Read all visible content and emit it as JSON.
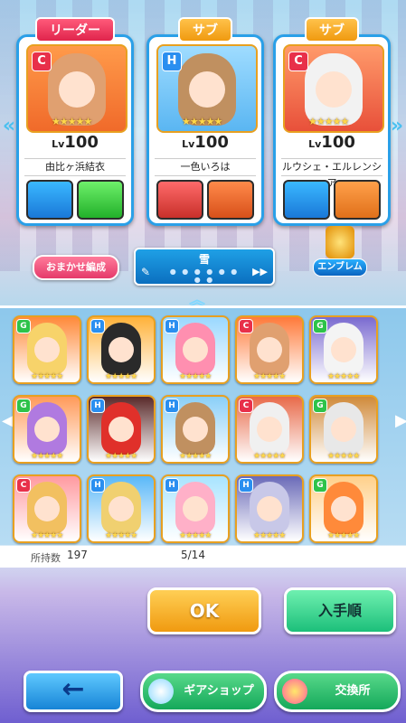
{
  "party": {
    "cards": [
      {
        "role": "リーダー",
        "type": "C",
        "level_prefix": "Lv",
        "level": "100",
        "name": "由比ヶ浜結衣",
        "stars": "★★★★★"
      },
      {
        "role": "サブ",
        "type": "H",
        "level_prefix": "Lv",
        "level": "100",
        "name": "一色いろは",
        "stars": "★★★★★"
      },
      {
        "role": "サブ",
        "type": "C",
        "level_prefix": "Lv",
        "level": "100",
        "name": "ルウシェ・エルレンシア",
        "stars": "★★★★★"
      }
    ]
  },
  "controls": {
    "omakase_label": "おまかせ編成",
    "deck_name": "雪",
    "deck_dots": "● ● ● ● ● ● ● ●",
    "emblem_label": "エンブレム"
  },
  "units": [
    {
      "type": "G",
      "stars": "★★★★★",
      "color": "#2ec34a",
      "hair": "#f7d36a",
      "bg": "#ff8a3a"
    },
    {
      "type": "H",
      "stars": "★★★★★",
      "color": "#2a8ff0",
      "hair": "#2a2a2a",
      "bg": "#ffb23a"
    },
    {
      "type": "H",
      "stars": "★★★★★",
      "color": "#2a8ff0",
      "hair": "#ff8fb0",
      "bg": "#9ad8ff"
    },
    {
      "type": "C",
      "stars": "★★★★★",
      "color": "#e8304a",
      "hair": "#e0a070",
      "bg": "#ff7a3a"
    },
    {
      "type": "G",
      "stars": "★★★★★",
      "color": "#2ec34a",
      "hair": "#f4f4f4",
      "bg": "#7a6ad0"
    },
    {
      "type": "G",
      "stars": "★★★★★",
      "color": "#2ec34a",
      "hair": "#b07ae0",
      "bg": "#ff9a5a"
    },
    {
      "type": "H",
      "stars": "★★★★★",
      "color": "#2a8ff0",
      "hair": "#e0302a",
      "bg": "#5a2a2a"
    },
    {
      "type": "H",
      "stars": "★★★★★",
      "color": "#2a8ff0",
      "hair": "#c09060",
      "bg": "#8acff8"
    },
    {
      "type": "C",
      "stars": "★★★★★",
      "color": "#e8304a",
      "hair": "#f0f0f0",
      "bg": "#e86a4a"
    },
    {
      "type": "G",
      "stars": "★★★★★",
      "color": "#2ec34a",
      "hair": "#e8e8e8",
      "bg": "#d08a3a"
    },
    {
      "type": "C",
      "stars": "★★★★★",
      "color": "#e8304a",
      "hair": "#f2c060",
      "bg": "#ff9aa0"
    },
    {
      "type": "H",
      "stars": "★★★★★",
      "color": "#2a8ff0",
      "hair": "#f0d070",
      "bg": "#5ab8f8"
    },
    {
      "type": "H",
      "stars": "★★★★★",
      "color": "#2a8ff0",
      "hair": "#ffb0c8",
      "bg": "#a8e4ff"
    },
    {
      "type": "H",
      "stars": "★★★★★",
      "color": "#2a8ff0",
      "hair": "#c8c8e8",
      "bg": "#6a6ab8"
    },
    {
      "type": "G",
      "stars": "★★★★★",
      "color": "#2ec34a",
      "hair": "#ff8a3a",
      "bg": "#ffd08a"
    }
  ],
  "footer_stats": {
    "owned_label": "所持数",
    "owned_count": "197",
    "page": "5/14"
  },
  "buttons": {
    "ok": "OK",
    "sort": "入手順",
    "back_icon": "←",
    "gear_shop": "ギアショップ",
    "exchange": "交換所"
  },
  "colors": {
    "leader_tag": "#e0244c",
    "sub_tag": "#f09a10",
    "card_border": "#2aa0e8",
    "ok": "#f09a10",
    "sort": "#1cbf7a"
  }
}
